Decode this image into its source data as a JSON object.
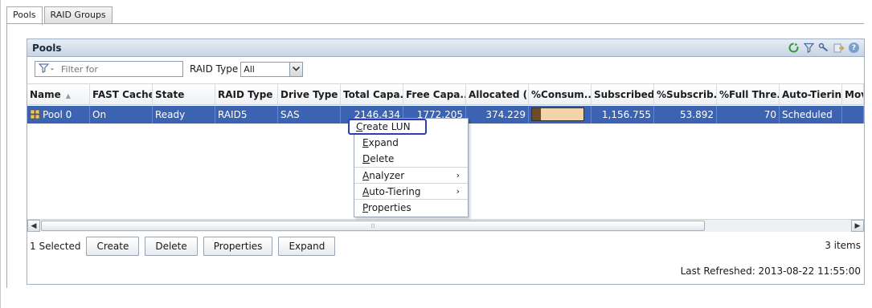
{
  "tabs": [
    {
      "label": "Pools",
      "active": true
    },
    {
      "label": "RAID Groups",
      "active": false
    }
  ],
  "panel": {
    "title": "Pools",
    "tool_icons": [
      "refresh-icon",
      "filter-icon",
      "wrench-icon",
      "export-icon",
      "help-icon"
    ]
  },
  "filter": {
    "placeholder": "Filter for",
    "raid_type_label": "RAID Type",
    "raid_type_value": "All"
  },
  "table": {
    "columns": [
      "Name",
      "FAST Cache",
      "State",
      "RAID Type",
      "Drive Type",
      "Total Capa...",
      "Free Capa...",
      "Allocated (...",
      "%Consum...",
      "Subscribed...",
      "%Subscrib...",
      "%Full Thre...",
      "Auto-Tierin...",
      "Mov"
    ],
    "rows": [
      {
        "name": "Pool 0",
        "fast_cache": "On",
        "state": "Ready",
        "raid_type": "RAID5",
        "drive_type": "SAS",
        "total_capacity": "2146.434",
        "free_capacity": "1772.205",
        "allocated": "374.229",
        "consumed_percent": 17.4,
        "subscribed": "1,156.755",
        "subscribed_percent": "53.892",
        "full_threshold": "70",
        "auto_tiering": "Scheduled",
        "mov": ""
      }
    ]
  },
  "context_menu": {
    "items": [
      {
        "label": "Create LUN",
        "underline": "C",
        "rest": "reate LUN",
        "has_sub": false
      },
      {
        "label": "Expand",
        "underline": "E",
        "rest": "xpand",
        "has_sub": false
      },
      {
        "label": "Delete",
        "underline": "D",
        "rest": "elete",
        "has_sub": false
      },
      {
        "label": "Analyzer",
        "underline": "A",
        "rest": "nalyzer",
        "has_sub": true
      },
      {
        "label": "Auto-Tiering",
        "underline": "A",
        "rest": "uto-Tiering",
        "has_sub": true
      },
      {
        "label": "Properties",
        "underline": "P",
        "rest": "roperties",
        "has_sub": false
      }
    ],
    "sub_arrow": "›"
  },
  "bottom": {
    "selected_text": "1 Selected",
    "buttons": [
      "Create",
      "Delete",
      "Properties",
      "Expand"
    ],
    "items_count": "3 items",
    "last_refreshed": "Last Refreshed: 2013-08-22 11:55:00"
  }
}
